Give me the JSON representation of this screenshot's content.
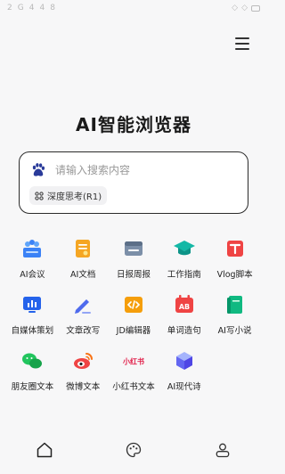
{
  "status_bar": {
    "left": [
      "2",
      "G",
      "4",
      "4",
      "8"
    ],
    "right": [
      "◇",
      "◇"
    ]
  },
  "menu": {
    "icon": "hamburger-menu-icon"
  },
  "app": {
    "title": "AI智能浏览器"
  },
  "search": {
    "engine_icon": "baidu-paw-icon",
    "placeholder": "请输入搜索内容",
    "deep_think_label": "深度思考(R1)",
    "deep_think_icon": "deep-think-icon"
  },
  "tools": [
    {
      "label": "AI会议",
      "icon": "meeting-icon",
      "color": "#3b82f6"
    },
    {
      "label": "AI文档",
      "icon": "document-icon",
      "color": "#f5a623"
    },
    {
      "label": "日报周报",
      "icon": "report-icon",
      "color": "#7c8fa8"
    },
    {
      "label": "工作指南",
      "icon": "graduation-cap-icon",
      "color": "#14b8a6"
    },
    {
      "label": "Vlog脚本",
      "icon": "vlog-script-icon",
      "color": "#ef4444"
    },
    {
      "label": "自媒体策划",
      "icon": "media-plan-icon",
      "color": "#2563eb"
    },
    {
      "label": "文章改写",
      "icon": "pen-icon",
      "color": "#4f6bed"
    },
    {
      "label": "JD编辑器",
      "icon": "code-editor-icon",
      "color": "#f59e0b"
    },
    {
      "label": "单词造句",
      "icon": "word-sentence-icon",
      "color": "#ef4444"
    },
    {
      "label": "AI写小说",
      "icon": "book-icon",
      "color": "#10b981"
    },
    {
      "label": "朋友圈文本",
      "icon": "moments-icon",
      "color": "#22c55e"
    },
    {
      "label": "微博文本",
      "icon": "weibo-icon",
      "color": "#f97316"
    },
    {
      "label": "小红书文本",
      "icon": "xiaohongshu-icon",
      "color": "#e11d48",
      "icon_text": "小红书"
    },
    {
      "label": "AI现代诗",
      "icon": "poem-cube-icon",
      "color": "#6366f1"
    }
  ],
  "bottom_nav": [
    {
      "icon": "home-icon",
      "active": true
    },
    {
      "icon": "palette-icon",
      "active": false
    },
    {
      "icon": "profile-icon",
      "active": false
    }
  ]
}
